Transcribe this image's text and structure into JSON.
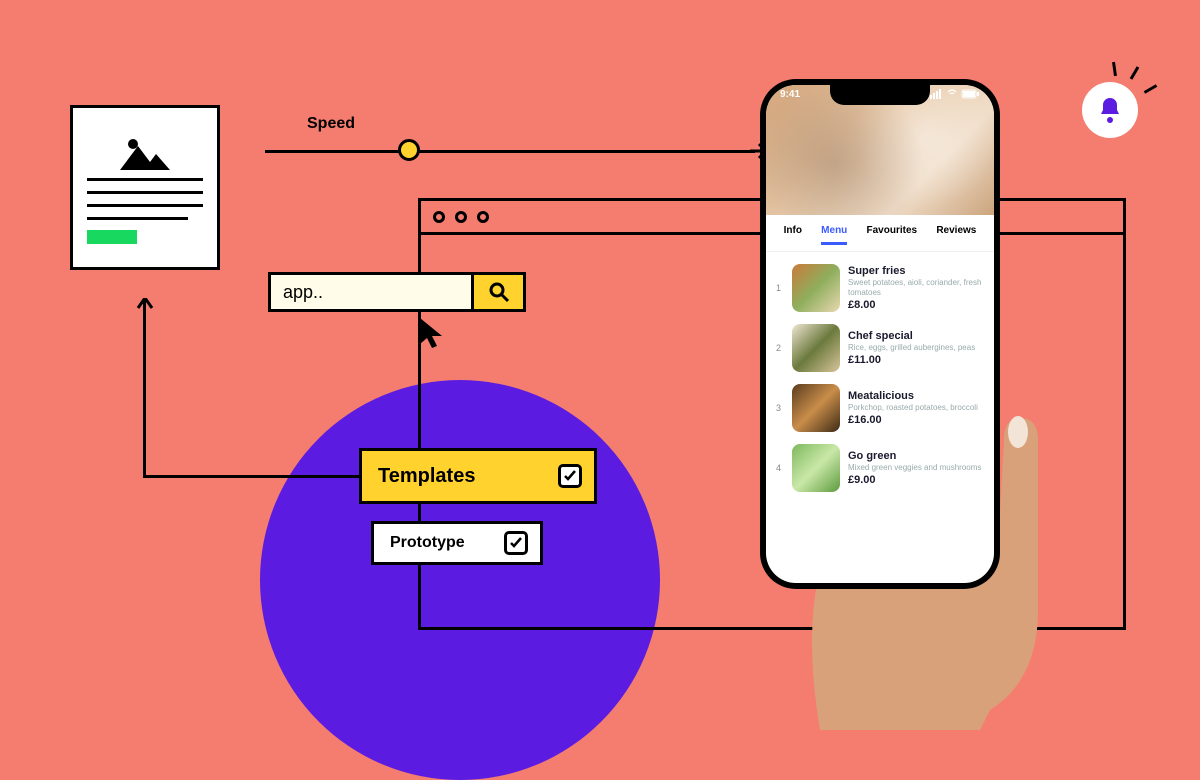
{
  "speed": {
    "label": "Speed"
  },
  "search": {
    "value": "app..",
    "icon": "search-icon"
  },
  "tags": {
    "templates": {
      "label": "Templates",
      "checked": true
    },
    "prototype": {
      "label": "Prototype",
      "checked": true
    }
  },
  "bell": {
    "icon": "bell-icon"
  },
  "phone": {
    "time": "9:41",
    "tabs": [
      "Info",
      "Menu",
      "Favourites",
      "Reviews"
    ],
    "active_tab": "Menu",
    "menu": [
      {
        "num": "1",
        "name": "Super fries",
        "desc": "Sweet potatoes, aioli, coriander, fresh tomatoes",
        "price": "£8.00"
      },
      {
        "num": "2",
        "name": "Chef special",
        "desc": "Rice, eggs, grilled aubergines, peas",
        "price": "£11.00"
      },
      {
        "num": "3",
        "name": "Meatalicious",
        "desc": "Porkchop, roasted potatoes, broccoli",
        "price": "£16.00"
      },
      {
        "num": "4",
        "name": "Go green",
        "desc": "Mixed green veggies and mushrooms",
        "price": "£9.00"
      }
    ]
  }
}
